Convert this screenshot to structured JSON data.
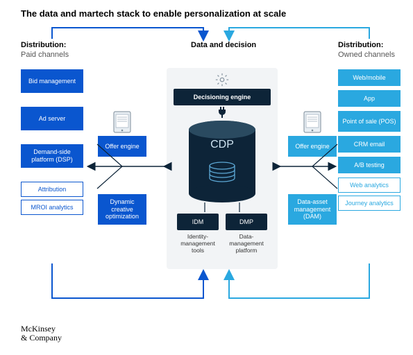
{
  "title": "The data and martech stack to enable personalization at scale",
  "columns": {
    "left": {
      "header1": "Distribution:",
      "header2": "Paid channels",
      "items": [
        "Bid management",
        "Ad server",
        "Demand-side platform (DSP)"
      ],
      "outlined": [
        "Attribution",
        "MROI analytics"
      ]
    },
    "center": {
      "header": "Data and decision",
      "decisioning": "Decisioning engine",
      "cdp": "CDP",
      "idm": {
        "label": "IDM",
        "caption": "Identity-management tools"
      },
      "dmp": {
        "label": "DMP",
        "caption": "Data-management platform"
      }
    },
    "right": {
      "header1": "Distribution:",
      "header2": "Owned channels",
      "items": [
        "Web/mobile",
        "App",
        "Point of sale (POS)",
        "CRM email",
        "A/B testing"
      ],
      "outlined": [
        "Web analytics",
        "Journey analytics"
      ]
    }
  },
  "middleLeft": {
    "offer": "Offer engine",
    "dynamic": "Dynamic creative optimization"
  },
  "middleRight": {
    "offer": "Offer engine",
    "dam": "Data-asset management (DAM)"
  },
  "logo": {
    "line1": "McKinsey",
    "line2": "& Company"
  },
  "colors": {
    "darkBlue": "#0a56cf",
    "lightBlue": "#2aa8e0",
    "navy": "#0d2438"
  }
}
